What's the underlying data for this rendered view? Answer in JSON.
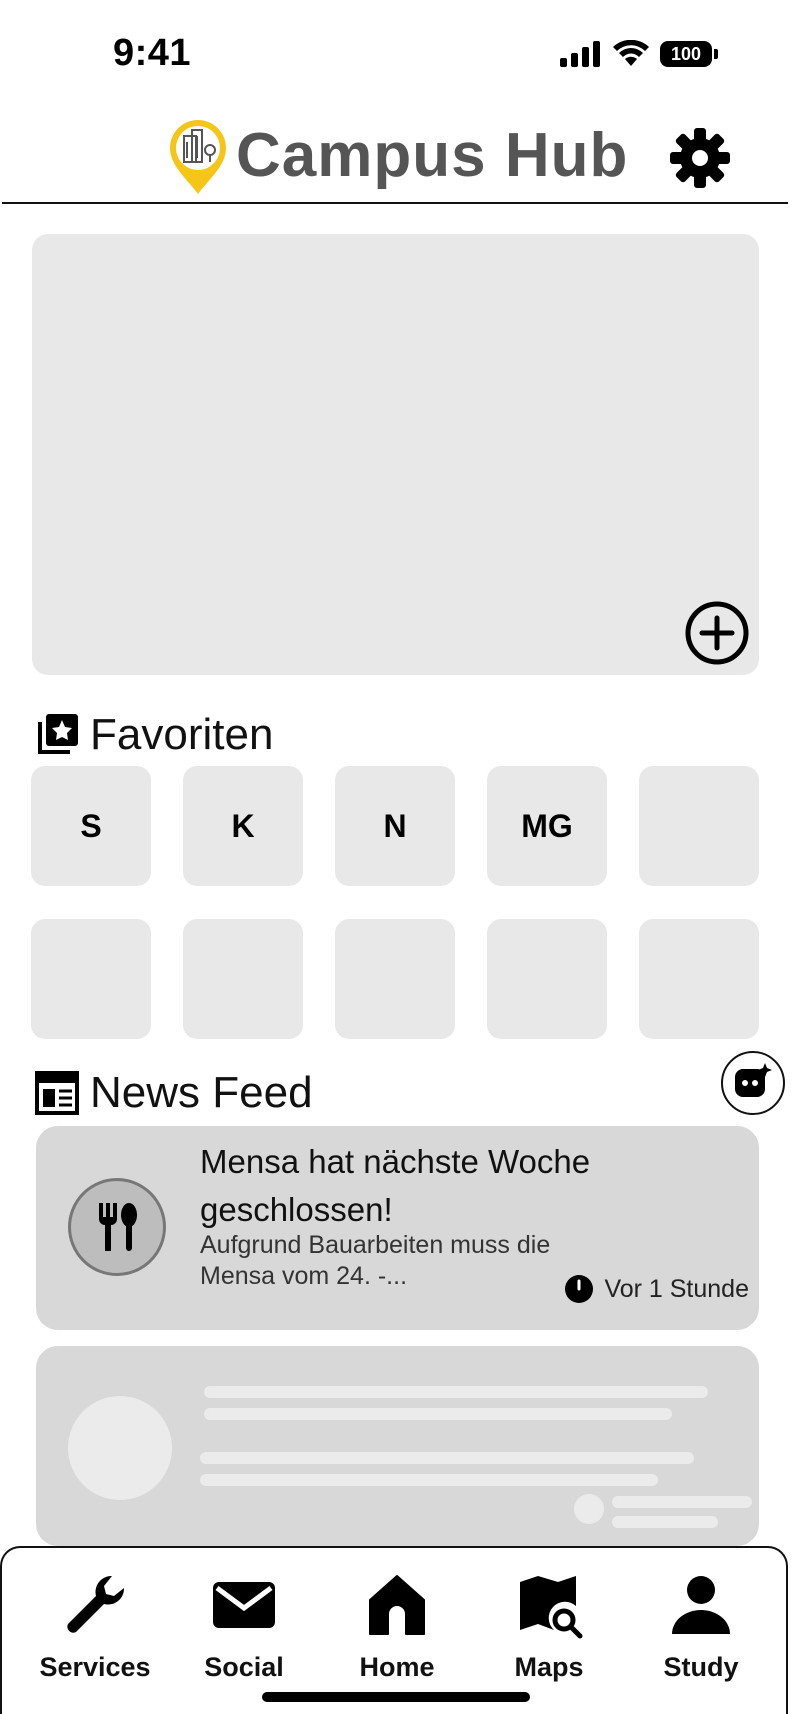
{
  "status_bar": {
    "time": "9:41",
    "battery": "100"
  },
  "header": {
    "title": "Campus Hub"
  },
  "favorites": {
    "title": "Favoriten",
    "tiles": [
      "S",
      "K",
      "N",
      "MG",
      "",
      "",
      "",
      "",
      "",
      ""
    ]
  },
  "news": {
    "title": "News Feed",
    "items": [
      {
        "title": "Mensa hat nächste Woche geschlossen!",
        "description": "Aufgrund Bauarbeiten muss die Mensa vom 24. -...",
        "time": "Vor 1 Stunde"
      }
    ]
  },
  "nav": {
    "items": [
      {
        "label": "Services",
        "icon": "wrench-icon"
      },
      {
        "label": "Social",
        "icon": "mail-icon"
      },
      {
        "label": "Home",
        "icon": "home-icon"
      },
      {
        "label": "Maps",
        "icon": "map-search-icon"
      },
      {
        "label": "Study",
        "icon": "person-icon"
      }
    ]
  },
  "colors": {
    "accent": "#f5c518",
    "surface": "#e8e8e8",
    "card": "#d8d8d8"
  }
}
